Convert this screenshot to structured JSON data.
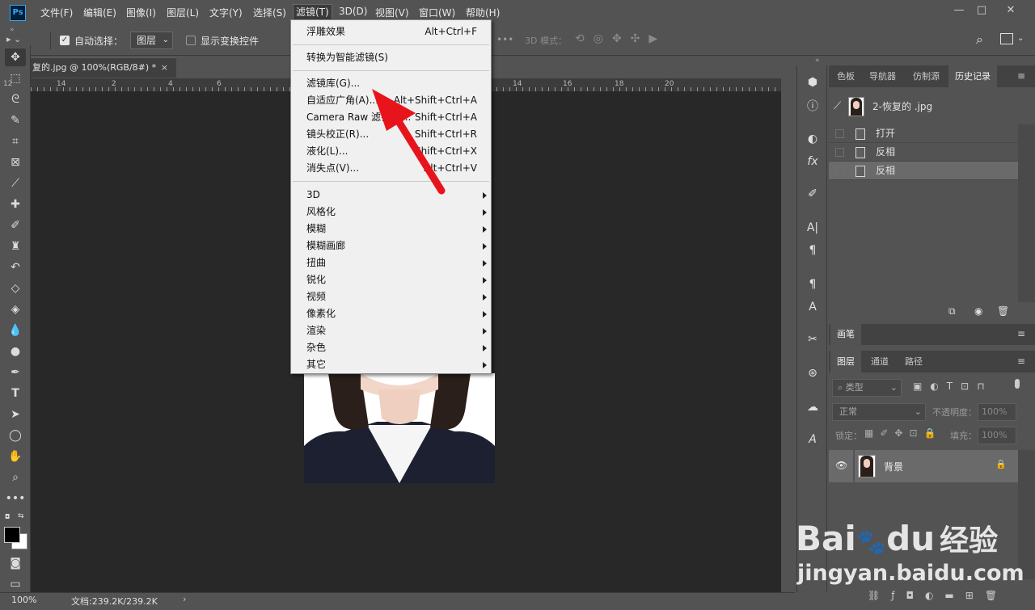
{
  "app": {
    "logo_text": "Ps"
  },
  "menubar": {
    "items": [
      "文件(F)",
      "编辑(E)",
      "图像(I)",
      "图层(L)",
      "文字(Y)",
      "选择(S)",
      "滤镜(T)",
      "3D(D)",
      "视图(V)",
      "窗口(W)",
      "帮助(H)"
    ],
    "active": "滤镜(T)"
  },
  "window_controls": {
    "minimize": "—",
    "maximize": "□",
    "close": "✕"
  },
  "options_bar": {
    "auto_select_label": "自动选择：",
    "auto_select_checked": true,
    "layer_select_value": "图层",
    "show_transform_label": "显示变换控件",
    "mode_3d_label": "3D 模式："
  },
  "document": {
    "tab_title": "复的.jpg @ 100%(RGB/8#) *",
    "tab_close": "×",
    "ruler_marks": [
      "12",
      "14",
      "2",
      "4",
      "6",
      "8",
      "10",
      "12",
      "14",
      "16",
      "18",
      "20"
    ],
    "status_zoom": "100%",
    "status_doc": "文档:239.2K/239.2K"
  },
  "filter_menu": {
    "last_filter": {
      "label": "浮雕效果",
      "shortcut": "Alt+Ctrl+F"
    },
    "convert_smart": "转换为智能滤镜(S)",
    "items": [
      {
        "label": "滤镜库(G)...",
        "shortcut": ""
      },
      {
        "label": "自适应广角(A)...",
        "shortcut": "Alt+Shift+Ctrl+A"
      },
      {
        "label": "Camera Raw 滤镜(C)...",
        "shortcut": "Shift+Ctrl+A"
      },
      {
        "label": "镜头校正(R)...",
        "shortcut": "Shift+Ctrl+R"
      },
      {
        "label": "液化(L)...",
        "shortcut": "Shift+Ctrl+X"
      },
      {
        "label": "消失点(V)...",
        "shortcut": "Alt+Ctrl+V"
      }
    ],
    "submenus": [
      "3D",
      "风格化",
      "模糊",
      "模糊画廊",
      "扭曲",
      "锐化",
      "视频",
      "像素化",
      "渲染",
      "杂色",
      "其它"
    ]
  },
  "history_panel": {
    "tabs": [
      "色板",
      "导航器",
      "仿制源",
      "历史记录"
    ],
    "active_tab": "历史记录",
    "snapshot": "2-恢复的 .jpg",
    "steps": [
      "打开",
      "反相",
      "反相"
    ],
    "selected_step": 2
  },
  "brush_panel": {
    "tab": "画笔"
  },
  "layers_panel": {
    "tabs": [
      "图层",
      "通道",
      "路径"
    ],
    "active_tab": "图层",
    "filter_placeholder": "类型",
    "blend_mode": "正常",
    "opacity_label": "不透明度：",
    "opacity_value": "100%",
    "lock_label": "锁定：",
    "fill_label": "填充：",
    "fill_value": "100%",
    "layers": [
      {
        "name": "背景",
        "locked": true,
        "visible": true
      }
    ]
  },
  "watermark": {
    "brand": "Bai",
    "brand2": "du",
    "cn": "经验",
    "url": "jingyan.baidu.com"
  },
  "colors": {
    "annotation_arrow": "#e8141c",
    "panel_bg": "#535353",
    "canvas_bg": "#282828",
    "menu_bg": "#f0f0f0"
  }
}
